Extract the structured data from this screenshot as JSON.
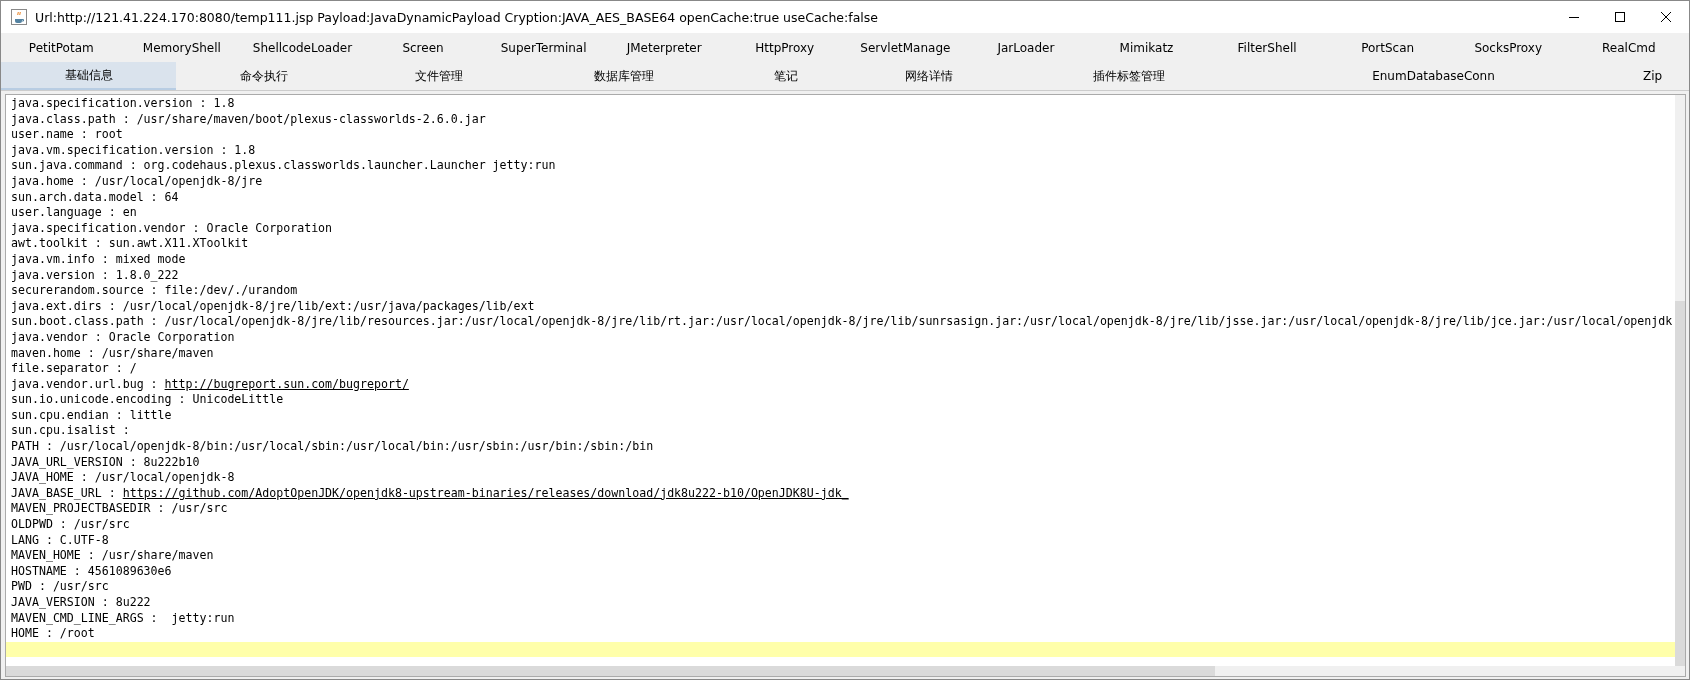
{
  "window": {
    "title": "Url:http://121.41.224.170:8080/temp111.jsp Payload:JavaDynamicPayload Cryption:JAVA_AES_BASE64 openCache:true useCache:false"
  },
  "plugin_tabs": [
    {
      "label": "PetitPotam",
      "selected": false
    },
    {
      "label": "MemoryShell",
      "selected": false
    },
    {
      "label": "ShellcodeLoader",
      "selected": false
    },
    {
      "label": "Screen",
      "selected": false
    },
    {
      "label": "SuperTerminal",
      "selected": false
    },
    {
      "label": "JMeterpreter",
      "selected": false
    },
    {
      "label": "HttpProxy",
      "selected": false
    },
    {
      "label": "ServletManage",
      "selected": false
    },
    {
      "label": "JarLoader",
      "selected": false
    },
    {
      "label": "Mimikatz",
      "selected": false
    },
    {
      "label": "FilterShell",
      "selected": false
    },
    {
      "label": "PortScan",
      "selected": false
    },
    {
      "label": "SocksProxy",
      "selected": false
    },
    {
      "label": "RealCmd",
      "selected": false
    }
  ],
  "tabs": [
    {
      "label": "基础信息",
      "selected": true
    },
    {
      "label": "命令执行",
      "selected": false
    },
    {
      "label": "文件管理",
      "selected": false
    },
    {
      "label": "数据库管理",
      "selected": false
    },
    {
      "label": "笔记",
      "selected": false
    },
    {
      "label": "网络详情",
      "selected": false
    },
    {
      "label": "插件标签管理",
      "selected": false
    },
    {
      "label": "EnumDatabaseConn",
      "selected": false
    },
    {
      "label": "Zip",
      "selected": false
    }
  ],
  "info_lines": [
    {
      "text": "java.specification.version : 1.8"
    },
    {
      "text": "java.class.path : /usr/share/maven/boot/plexus-classworlds-2.6.0.jar"
    },
    {
      "text": "user.name : root"
    },
    {
      "text": "java.vm.specification.version : 1.8"
    },
    {
      "text": "sun.java.command : org.codehaus.plexus.classworlds.launcher.Launcher jetty:run"
    },
    {
      "text": "java.home : /usr/local/openjdk-8/jre"
    },
    {
      "text": "sun.arch.data.model : 64"
    },
    {
      "text": "user.language : en"
    },
    {
      "text": "java.specification.vendor : Oracle Corporation"
    },
    {
      "text": "awt.toolkit : sun.awt.X11.XToolkit"
    },
    {
      "text": "java.vm.info : mixed mode"
    },
    {
      "text": "java.version : 1.8.0_222"
    },
    {
      "text": "securerandom.source : file:/dev/./urandom"
    },
    {
      "text": "java.ext.dirs : /usr/local/openjdk-8/jre/lib/ext:/usr/java/packages/lib/ext"
    },
    {
      "text": "sun.boot.class.path : /usr/local/openjdk-8/jre/lib/resources.jar:/usr/local/openjdk-8/jre/lib/rt.jar:/usr/local/openjdk-8/jre/lib/sunrsasign.jar:/usr/local/openjdk-8/jre/lib/jsse.jar:/usr/local/openjdk-8/jre/lib/jce.jar:/usr/local/openjdk"
    },
    {
      "text": "java.vendor : Oracle Corporation"
    },
    {
      "text": "maven.home : /usr/share/maven"
    },
    {
      "text": "file.separator : /"
    },
    {
      "text": "java.vendor.url.bug : ",
      "link": "http://bugreport.sun.com/bugreport/"
    },
    {
      "text": "sun.io.unicode.encoding : UnicodeLittle"
    },
    {
      "text": "sun.cpu.endian : little"
    },
    {
      "text": "sun.cpu.isalist :"
    },
    {
      "text": "PATH : /usr/local/openjdk-8/bin:/usr/local/sbin:/usr/local/bin:/usr/sbin:/usr/bin:/sbin:/bin"
    },
    {
      "text": "JAVA_URL_VERSION : 8u222b10"
    },
    {
      "text": "JAVA_HOME : /usr/local/openjdk-8"
    },
    {
      "text": "JAVA_BASE_URL : ",
      "link": "https://github.com/AdoptOpenJDK/openjdk8-upstream-binaries/releases/download/jdk8u222-b10/OpenJDK8U-jdk_"
    },
    {
      "text": "MAVEN_PROJECTBASEDIR : /usr/src"
    },
    {
      "text": "OLDPWD : /usr/src"
    },
    {
      "text": "LANG : C.UTF-8"
    },
    {
      "text": "MAVEN_HOME : /usr/share/maven"
    },
    {
      "text": "HOSTNAME : 4561089630e6"
    },
    {
      "text": "PWD : /usr/src"
    },
    {
      "text": "JAVA_VERSION : 8u222"
    },
    {
      "text": "MAVEN_CMD_LINE_ARGS :  jetty:run"
    },
    {
      "text": "HOME : /root"
    }
  ]
}
